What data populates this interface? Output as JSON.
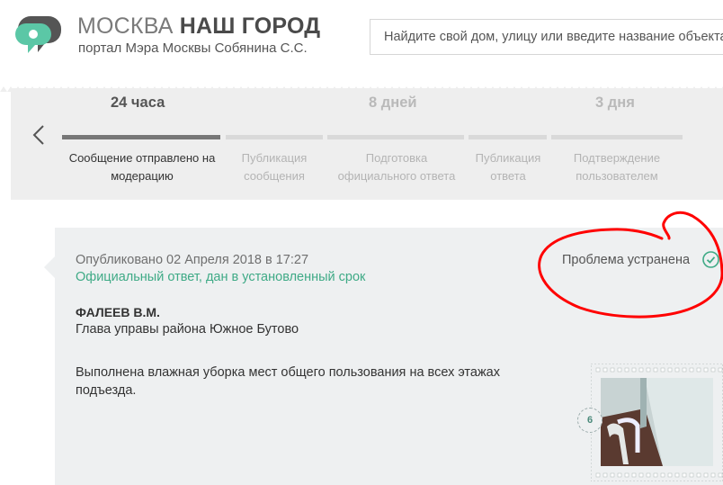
{
  "header": {
    "brand_light": "МОСКВА",
    "brand_bold": "НАШ ГОРОД",
    "subtitle": "портал Мэра Москвы Собянина С.С.",
    "logo_icon": "speech-bubbles-logo"
  },
  "search": {
    "placeholder": "Найдите свой дом, улицу или введите название объекта"
  },
  "timeline": {
    "durations": [
      "24 часа",
      "8 дней",
      "3 дня"
    ],
    "steps": [
      {
        "label_line1": "Сообщение отправлено на",
        "label_line2": "модерацию",
        "state": "active"
      },
      {
        "label_line1": "Публикация",
        "label_line2": "сообщения",
        "state": "inactive"
      },
      {
        "label_line1": "Подготовка",
        "label_line2": "официального ответа",
        "state": "inactive"
      },
      {
        "label_line1": "Публикация",
        "label_line2": "ответа",
        "state": "inactive"
      },
      {
        "label_line1": "Подтверждение",
        "label_line2": "пользователем",
        "state": "inactive"
      }
    ]
  },
  "response": {
    "published": "Опубликовано 02 Апреля 2018 в 17:27",
    "official_note": "Официальный ответ, дан в установленный срок",
    "status": "Проблема устранена",
    "author": "ФАЛЕЕВ В.М.",
    "role": "Глава управы района Южное Бутово",
    "answer": "Выполнена влажная уборка мест общего пользования на всех этажах подъезда.",
    "photo_count": "6"
  },
  "colors": {
    "accent_green": "#3faa86",
    "annotation_red": "#ff0000",
    "logo_green": "#5bc7a6"
  }
}
